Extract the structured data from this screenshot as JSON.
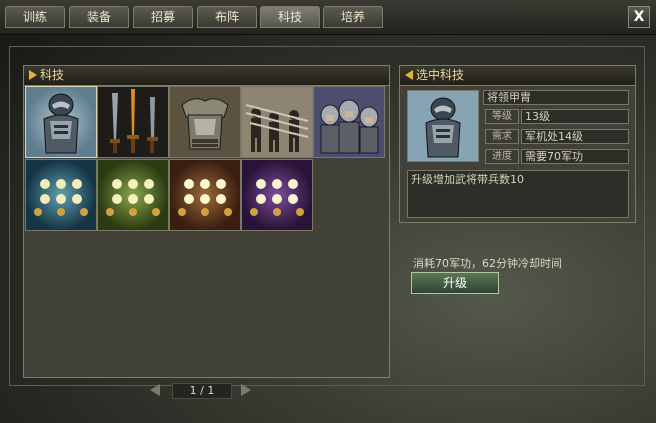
{
  "tabs": [
    {
      "label": "训练"
    },
    {
      "label": "装备"
    },
    {
      "label": "招募"
    },
    {
      "label": "布阵"
    },
    {
      "label": "科技",
      "active": true
    },
    {
      "label": "培养"
    }
  ],
  "close_label": "X",
  "tech_panel": {
    "title": "科技"
  },
  "tech_items": [
    {
      "icon": "armored-general-icon",
      "selected": true
    },
    {
      "icon": "swords-icon"
    },
    {
      "icon": "breastplate-armor-icon"
    },
    {
      "icon": "spear-soldiers-icon"
    },
    {
      "icon": "helmeted-soldiers-icon"
    },
    {
      "icon": "formation-teal-icon"
    },
    {
      "icon": "formation-green-icon"
    },
    {
      "icon": "formation-brown-icon"
    },
    {
      "icon": "formation-purple-icon"
    }
  ],
  "pager": {
    "text": "1 / 1"
  },
  "detail": {
    "title": "选中科技",
    "name": "将领甲胄",
    "level_label": "等级",
    "level_value": "13级",
    "req_label": "需求",
    "req_value": "军机处14级",
    "progress_label": "进度",
    "progress_value": "需要70军功",
    "description": "升级增加武将带兵数10",
    "cost_text": "消耗70军功，62分钟冷却时间",
    "upgrade_label": "升级"
  }
}
